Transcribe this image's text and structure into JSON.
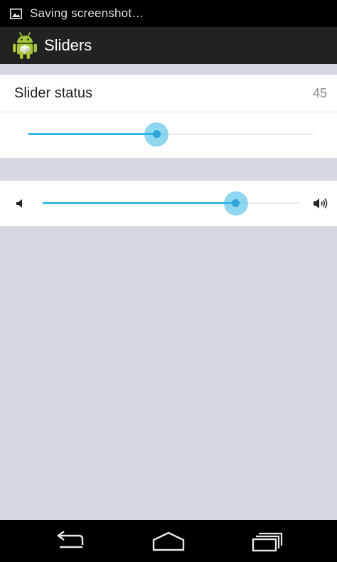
{
  "status_bar": {
    "notification_icon": "image-icon",
    "text": "Saving screenshot…"
  },
  "action_bar": {
    "app_icon": "android-robot-icon",
    "title": "Sliders"
  },
  "status_card": {
    "label": "Slider status",
    "value": "45",
    "slider": {
      "value": 45,
      "min": 0,
      "max": 100
    }
  },
  "volume_card": {
    "low_icon": "volume-low-icon",
    "high_icon": "volume-high-icon",
    "slider": {
      "value": 75,
      "min": 0,
      "max": 100
    }
  },
  "nav_bar": {
    "back_icon": "back-icon",
    "home_icon": "home-icon",
    "recents_icon": "recents-icon"
  },
  "colors": {
    "accent": "#33b5e5",
    "action_bar_bg": "#222222",
    "content_bg": "#d4d7df"
  }
}
